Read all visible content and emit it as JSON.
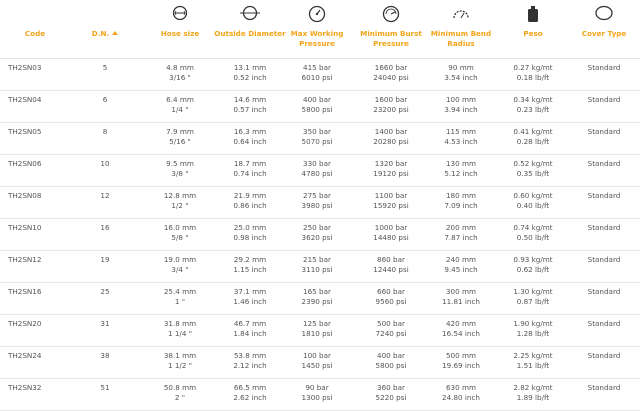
{
  "columns": {
    "code": "Code",
    "dn": "D.N.",
    "hose_size": "Hose size",
    "outside_diameter": "Outside Diameter",
    "max_working_pressure": [
      "Max Working",
      "Pressure"
    ],
    "min_burst_pressure": [
      "Minimum Burst",
      "Pressure"
    ],
    "min_bend_radius": [
      "Minimum Bend",
      "Radius"
    ],
    "peso": "Peso",
    "cover_type": "Cover Type"
  },
  "icons": {
    "hose_size": "circle-ring-icon",
    "outside_diameter": "diameter-circle-icon",
    "max_working_pressure": "pressure-gauge-icon",
    "min_burst_pressure": "burst-pressure-icon",
    "min_bend_radius": "bend-radius-icon",
    "peso": "weight-icon",
    "cover_type": "cover-oval-icon"
  },
  "accent_color": "#f2a51a",
  "rows": [
    {
      "code": "TH2SN03",
      "dn": "5",
      "hose_mm": "4.8 mm",
      "hose_in": "3/16 \"",
      "od_mm": "13.1 mm",
      "od_in": "0.52 inch",
      "mwp_bar": "415 bar",
      "mwp_psi": "6010 psi",
      "mbp_bar": "1660 bar",
      "mbp_psi": "24040 psi",
      "mbr_mm": "90 mm",
      "mbr_in": "3.54 inch",
      "peso_kg": "0.27 kg/mt",
      "peso_lb": "0.18 lb/ft",
      "cover": "Standard"
    },
    {
      "code": "TH2SN04",
      "dn": "6",
      "hose_mm": "6.4 mm",
      "hose_in": "1/4 \"",
      "od_mm": "14.6 mm",
      "od_in": "0.57 inch",
      "mwp_bar": "400 bar",
      "mwp_psi": "5800 psi",
      "mbp_bar": "1600 bar",
      "mbp_psi": "23200 psi",
      "mbr_mm": "100 mm",
      "mbr_in": "3.94 inch",
      "peso_kg": "0.34 kg/mt",
      "peso_lb": "0.23 lb/ft",
      "cover": "Standard"
    },
    {
      "code": "TH2SN05",
      "dn": "8",
      "hose_mm": "7.9 mm",
      "hose_in": "5/16 \"",
      "od_mm": "16.3 mm",
      "od_in": "0.64 inch",
      "mwp_bar": "350 bar",
      "mwp_psi": "5070 psi",
      "mbp_bar": "1400 bar",
      "mbp_psi": "20280 psi",
      "mbr_mm": "115 mm",
      "mbr_in": "4.53 inch",
      "peso_kg": "0.41 kg/mt",
      "peso_lb": "0.28 lb/ft",
      "cover": "Standard"
    },
    {
      "code": "TH2SN06",
      "dn": "10",
      "hose_mm": "9.5 mm",
      "hose_in": "3/8 \"",
      "od_mm": "18.7 mm",
      "od_in": "0.74 inch",
      "mwp_bar": "330 bar",
      "mwp_psi": "4780 psi",
      "mbp_bar": "1320 bar",
      "mbp_psi": "19120 psi",
      "mbr_mm": "130 mm",
      "mbr_in": "5.12 inch",
      "peso_kg": "0.52 kg/mt",
      "peso_lb": "0.35 lb/ft",
      "cover": "Standard"
    },
    {
      "code": "TH2SN08",
      "dn": "12",
      "hose_mm": "12.8 mm",
      "hose_in": "1/2 \"",
      "od_mm": "21.9 mm",
      "od_in": "0.86 inch",
      "mwp_bar": "275 bar",
      "mwp_psi": "3980 psi",
      "mbp_bar": "1100 bar",
      "mbp_psi": "15920 psi",
      "mbr_mm": "180 mm",
      "mbr_in": "7.09 inch",
      "peso_kg": "0.60 kg/mt",
      "peso_lb": "0.40 lb/ft",
      "cover": "Standard"
    },
    {
      "code": "TH2SN10",
      "dn": "16",
      "hose_mm": "16.0 mm",
      "hose_in": "5/8 \"",
      "od_mm": "25.0 mm",
      "od_in": "0.98 inch",
      "mwp_bar": "250 bar",
      "mwp_psi": "3620 psi",
      "mbp_bar": "1000 bar",
      "mbp_psi": "14480 psi",
      "mbr_mm": "200 mm",
      "mbr_in": "7.87 inch",
      "peso_kg": "0.74 kg/mt",
      "peso_lb": "0.50 lb/ft",
      "cover": "Standard"
    },
    {
      "code": "TH2SN12",
      "dn": "19",
      "hose_mm": "19.0 mm",
      "hose_in": "3/4 \"",
      "od_mm": "29.2 mm",
      "od_in": "1.15 inch",
      "mwp_bar": "215 bar",
      "mwp_psi": "3110 psi",
      "mbp_bar": "860 bar",
      "mbp_psi": "12440 psi",
      "mbr_mm": "240 mm",
      "mbr_in": "9.45 inch",
      "peso_kg": "0.93 kg/mt",
      "peso_lb": "0.62 lb/ft",
      "cover": "Standard"
    },
    {
      "code": "TH2SN16",
      "dn": "25",
      "hose_mm": "25.4 mm",
      "hose_in": "1 \"",
      "od_mm": "37.1 mm",
      "od_in": "1.46 inch",
      "mwp_bar": "165 bar",
      "mwp_psi": "2390 psi",
      "mbp_bar": "660 bar",
      "mbp_psi": "9560 psi",
      "mbr_mm": "300 mm",
      "mbr_in": "11.81 inch",
      "peso_kg": "1.30 kg/mt",
      "peso_lb": "0.87 lb/ft",
      "cover": "Standard"
    },
    {
      "code": "TH2SN20",
      "dn": "31",
      "hose_mm": "31.8 mm",
      "hose_in": "1 1/4 \"",
      "od_mm": "46.7 mm",
      "od_in": "1.84 inch",
      "mwp_bar": "125 bar",
      "mwp_psi": "1810 psi",
      "mbp_bar": "500 bar",
      "mbp_psi": "7240 psi",
      "mbr_mm": "420 mm",
      "mbr_in": "16.54 inch",
      "peso_kg": "1.90 kg/mt",
      "peso_lb": "1.28 lb/ft",
      "cover": "Standard"
    },
    {
      "code": "TH2SN24",
      "dn": "38",
      "hose_mm": "38.1 mm",
      "hose_in": "1 1/2 \"",
      "od_mm": "53.8 mm",
      "od_in": "2.12 inch",
      "mwp_bar": "100 bar",
      "mwp_psi": "1450 psi",
      "mbp_bar": "400 bar",
      "mbp_psi": "5800 psi",
      "mbr_mm": "500 mm",
      "mbr_in": "19.69 inch",
      "peso_kg": "2.25 kg/mt",
      "peso_lb": "1.51 lb/ft",
      "cover": "Standard"
    },
    {
      "code": "TH2SN32",
      "dn": "51",
      "hose_mm": "50.8 mm",
      "hose_in": "2 \"",
      "od_mm": "66.5 mm",
      "od_in": "2.62 inch",
      "mwp_bar": "90 bar",
      "mwp_psi": "1300 psi",
      "mbp_bar": "360 bar",
      "mbp_psi": "5220 psi",
      "mbr_mm": "630 mm",
      "mbr_in": "24.80 inch",
      "peso_kg": "2.82 kg/mt",
      "peso_lb": "1.89 lb/ft",
      "cover": "Standard"
    }
  ]
}
